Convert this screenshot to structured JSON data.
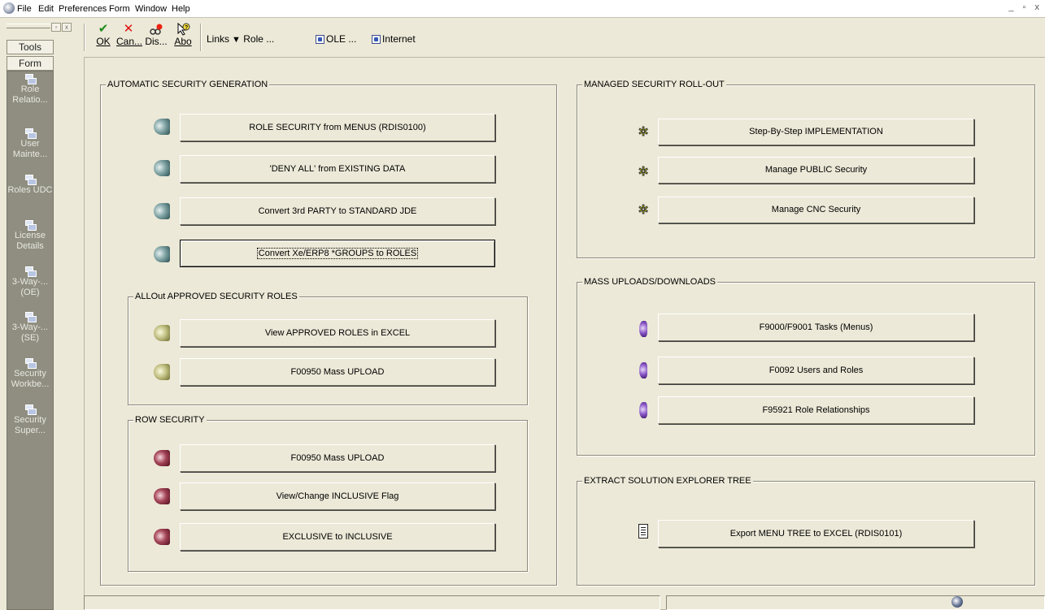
{
  "menubar": {
    "items": [
      "File",
      "Edit",
      "Preferences",
      "Form",
      "Window",
      "Help"
    ],
    "window_controls": "_ ▫ x"
  },
  "sidebar": {
    "tabs": [
      "Tools",
      "Form"
    ],
    "items": [
      {
        "label": "Role Relatio..."
      },
      {
        "label": "User Mainte..."
      },
      {
        "label": "Roles UDC"
      },
      {
        "label": "License Details"
      },
      {
        "label": "3-Way-... (OE)"
      },
      {
        "label": "3-Way-... (SE)"
      },
      {
        "label": "Security Workbe..."
      },
      {
        "label": "Security Super..."
      }
    ]
  },
  "toolbar": {
    "ok": {
      "glyph": "✔",
      "label": "OK"
    },
    "cancel": {
      "glyph": "✕",
      "label": "Can..."
    },
    "display": {
      "label": "Dis..."
    },
    "about": {
      "label": "Abo"
    },
    "links_label": "Links",
    "role_label": "Role ...",
    "ole_label": "OLE ...",
    "internet_label": "Internet"
  },
  "groups": {
    "auto": {
      "title": "AUTOMATIC SECURITY GENERATION",
      "buttons": [
        "ROLE SECURITY from MENUS (RDIS0100)",
        "'DENY ALL' from EXISTING DATA",
        "Convert 3rd PARTY to STANDARD JDE",
        "Convert Xe/ERP8 *GROUPS to ROLES"
      ]
    },
    "approved": {
      "title": "ALLOut APPROVED SECURITY ROLES",
      "buttons": [
        "View APPROVED ROLES in EXCEL",
        "F00950 Mass UPLOAD"
      ]
    },
    "row": {
      "title": "ROW SECURITY",
      "buttons": [
        "F00950 Mass UPLOAD",
        "View/Change INCLUSIVE Flag",
        "EXCLUSIVE to INCLUSIVE"
      ]
    },
    "managed": {
      "title": "MANAGED SECURITY ROLL-OUT",
      "buttons": [
        "Step-By-Step IMPLEMENTATION",
        "Manage PUBLIC Security",
        "Manage CNC Security"
      ]
    },
    "mass": {
      "title": "MASS UPLOADS/DOWNLOADS",
      "buttons": [
        "F9000/F9001 Tasks (Menus)",
        "F0092 Users and Roles",
        "F95921 Role Relationships"
      ]
    },
    "extract": {
      "title": "EXTRACT SOLUTION EXPLORER TREE",
      "buttons": [
        "Export MENU TREE to EXCEL (RDIS0101)"
      ]
    }
  },
  "colors": {
    "background": "#ece9d8",
    "exit_bar": "#8f8e81",
    "teal_icon": "#5c8586",
    "olive_icon": "#a9a864",
    "maroon_icon": "#8c2a40",
    "purple_icon": "#7446ad",
    "gear_icon": "#e0de00"
  }
}
